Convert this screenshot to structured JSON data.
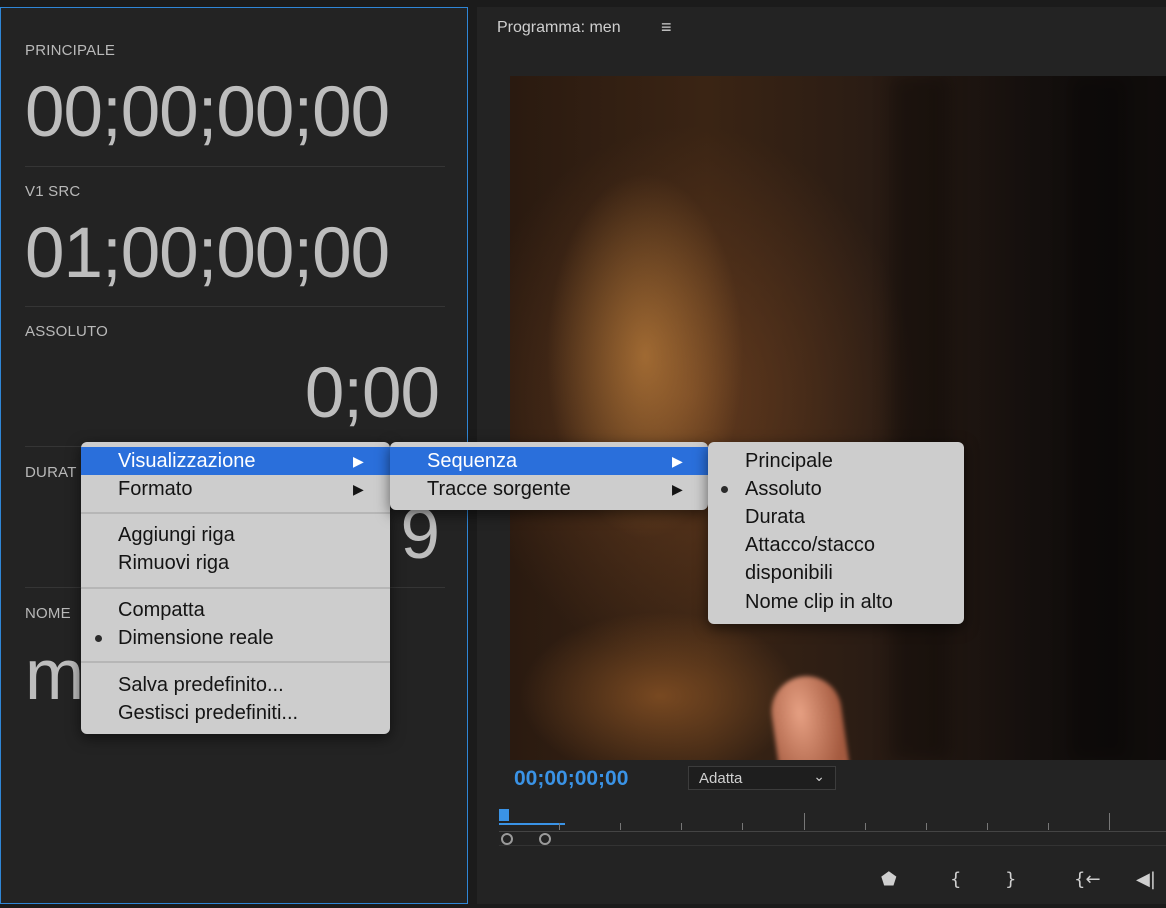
{
  "timecode_panel": {
    "rows": [
      {
        "label": "PRINCIPALE",
        "value": "00;00;00;00"
      },
      {
        "label": "V1 SRC",
        "value": "01;00;00;00"
      },
      {
        "label": "ASSOLUTO",
        "value": "0;00"
      },
      {
        "label": "DURAT",
        "value": "9"
      },
      {
        "label": "NOME",
        "value": "m"
      }
    ]
  },
  "program_monitor": {
    "title": "Programma: men",
    "menu_icon": "hamburger-icon",
    "timecode": "00;00;00;00",
    "fit_select": "Adatta",
    "controls": [
      {
        "icon": "marker-icon",
        "glyph": "⬟"
      },
      {
        "icon": "mark-in-icon",
        "glyph": "{"
      },
      {
        "icon": "mark-out-icon",
        "glyph": "}"
      },
      {
        "icon": "go-to-in-icon",
        "glyph": "{←"
      },
      {
        "icon": "step-back-icon",
        "glyph": "◀|"
      }
    ]
  },
  "context_menu": {
    "main": [
      {
        "label": "Visualizzazione",
        "submenu": true,
        "highlighted": true
      },
      {
        "label": "Formato",
        "submenu": true
      },
      {
        "label": "Aggiungi riga"
      },
      {
        "label": "Rimuovi riga"
      },
      {
        "label": "Compatta"
      },
      {
        "label": "Dimensione reale",
        "checked": true
      },
      {
        "label": "Salva predefinito..."
      },
      {
        "label": "Gestisci predefiniti..."
      }
    ],
    "submenu_view": [
      {
        "label": "Sequenza",
        "submenu": true,
        "highlighted": true
      },
      {
        "label": "Tracce sorgente",
        "submenu": true
      }
    ],
    "submenu_sequence": [
      {
        "label": "Principale"
      },
      {
        "label": "Assoluto",
        "checked": true
      },
      {
        "label": "Durata"
      },
      {
        "label": "Attacco/stacco"
      },
      {
        "label": "disponibili"
      },
      {
        "label": "Nome clip in alto"
      }
    ],
    "submenu_arrow": "▶"
  },
  "colors": {
    "accent_blue": "#3a93e6",
    "menu_highlight": "#2a6fdb",
    "menu_bg": "#cdcdcd"
  }
}
